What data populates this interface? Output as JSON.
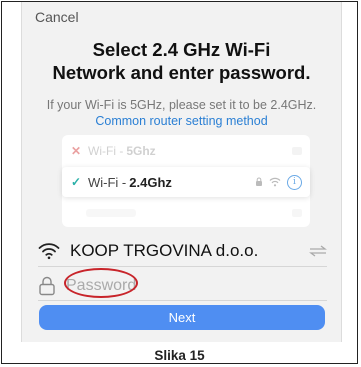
{
  "header": {
    "cancel_label": "Cancel"
  },
  "title": {
    "line1": "Select 2.4 GHz Wi-Fi",
    "line2": "Network and enter password."
  },
  "subtitle": {
    "text": "If your Wi-Fi is 5GHz, please set it to be 2.4GHz.",
    "link": "Common router setting method"
  },
  "wifi_illustration": {
    "rows": [
      {
        "prefix": "Wi-Fi -",
        "band": "5Ghz",
        "status": "unsupported"
      },
      {
        "prefix": "Wi-Fi -",
        "band": "2.4Ghz",
        "status": "supported"
      }
    ]
  },
  "form": {
    "ssid": "KOOP TRGOVINA d.o.o.",
    "password_placeholder": "Password"
  },
  "next_label": "Next",
  "caption": "Slika 15",
  "colors": {
    "accent": "#4f8ef2",
    "link": "#2a7fd4",
    "check": "#2ab0a8",
    "cross": "#d23030",
    "highlight": "#c8242a"
  }
}
